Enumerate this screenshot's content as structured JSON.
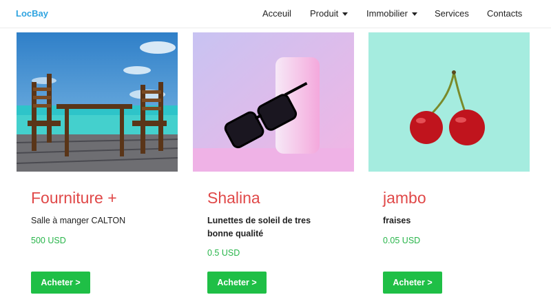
{
  "brand": "LocBay",
  "nav": {
    "items": [
      {
        "label": "Acceuil",
        "dropdown": false
      },
      {
        "label": "Produit",
        "dropdown": true
      },
      {
        "label": "Immobilier",
        "dropdown": true
      },
      {
        "label": "Services",
        "dropdown": false
      },
      {
        "label": "Contacts",
        "dropdown": false
      }
    ]
  },
  "products": [
    {
      "title": "Fourniture +",
      "description": "Salle à manger CALTON",
      "price": "500 USD",
      "button": "Acheter >",
      "image": "patio-table-chairs-beach"
    },
    {
      "title": "Shalina",
      "description": "Lunettes de soleil de tres bonne qualité",
      "price": "0.5 USD",
      "button": "Acheter >",
      "image": "sunglasses-pink"
    },
    {
      "title": "jambo",
      "description": "fraises",
      "price": "0.05 USD",
      "button": "Acheter >",
      "image": "cherries-mint"
    }
  ],
  "colors": {
    "brand": "#2ea3e0",
    "title": "#e04848",
    "price": "#28b54a",
    "button": "#1fbf46"
  }
}
